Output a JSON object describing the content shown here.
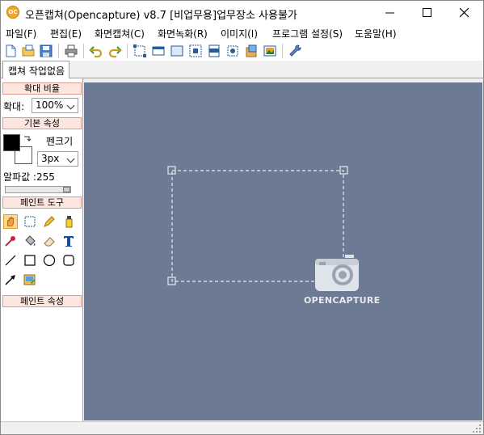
{
  "window": {
    "title": "오픈캡쳐(Opencapture) v8.7 [비업무용]업무장소 사용불가",
    "app_icon_text": "OC"
  },
  "menu": {
    "items": [
      {
        "label": "파일(F)"
      },
      {
        "label": "편집(E)"
      },
      {
        "label": "화면캡쳐(C)"
      },
      {
        "label": "화면녹화(R)"
      },
      {
        "label": "이미지(I)"
      },
      {
        "label": "프로그램 설정(S)"
      },
      {
        "label": "도움말(H)"
      }
    ]
  },
  "toolbar": {
    "icons": [
      "new-icon",
      "open-icon",
      "save-icon",
      "print-icon",
      "undo-icon",
      "redo-icon",
      "capture-region-icon",
      "capture-window-icon",
      "capture-fullscreen-icon",
      "capture-object-icon",
      "capture-scroll-icon",
      "capture-fixed-icon",
      "clipboard-image-icon",
      "image-viewer-icon",
      "settings-wrench-icon"
    ]
  },
  "tabs": [
    {
      "label": "캡쳐 작업없음"
    }
  ],
  "left_panel": {
    "zoom_section": "확대 비율",
    "zoom_label": "확대:",
    "zoom_value": "100%",
    "basic_section": "기본 속성",
    "pen_size_label": "펜크기",
    "pen_size_value": "3px",
    "alpha_label": "알파값 :255",
    "alpha_value": 255,
    "alpha_max": 255,
    "paint_tools_section": "페인트 도구",
    "paint_props_section": "페인트 속성",
    "fg_color": "#000000",
    "bg_color": "#ffffff"
  },
  "canvas": {
    "background": "#6c7a94",
    "logo_text": "OPENCAPTURE"
  }
}
